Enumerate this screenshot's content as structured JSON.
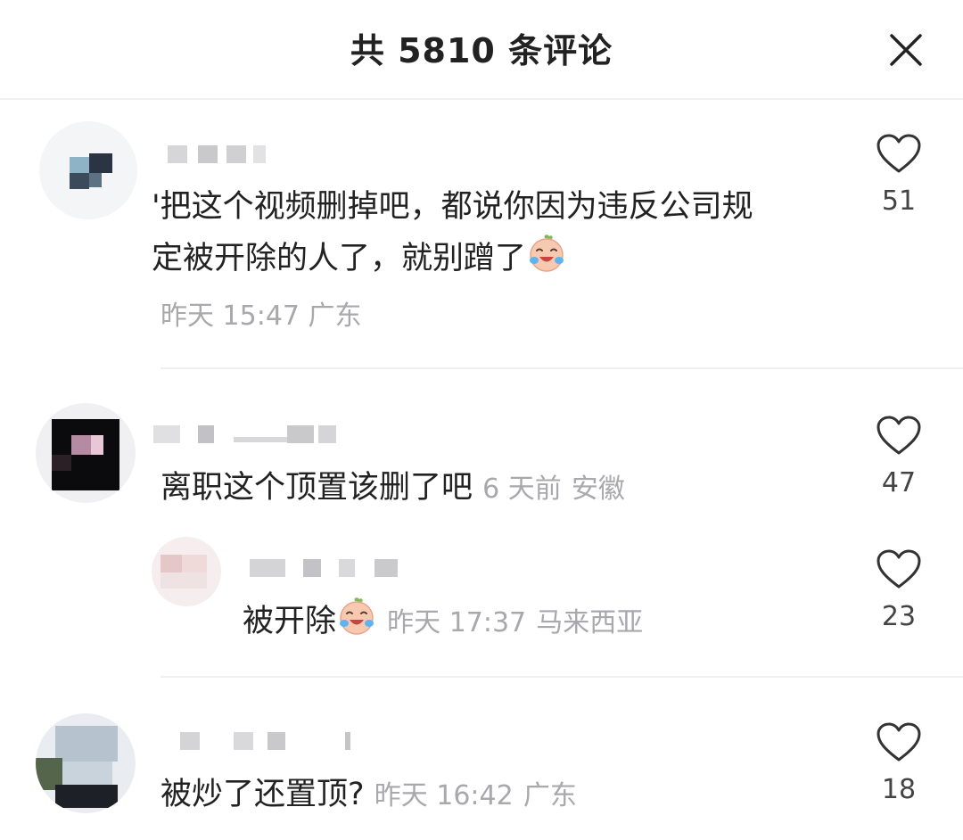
{
  "header": {
    "title": "共 5810 条评论"
  },
  "comments": [
    {
      "text": "'把这个视频删掉吧，都说你因为违反公司规定被开除的人了，就别蹭了",
      "line1": "'把这个视频删掉吧，都说你因为违反公司规",
      "line2": "定被开除的人了，就别蹭了",
      "time": "昨天 15:47",
      "location": "广东",
      "likes": "51",
      "emoji": "crying-laughing-face"
    },
    {
      "text": "离职这个顶置该删了吧",
      "time": "6 天前",
      "location": "安徽",
      "likes": "47"
    },
    {
      "text": "被开除",
      "time": "昨天 17:37",
      "location": "马来西亚",
      "likes": "23",
      "emoji": "crying-laughing-face",
      "is_reply": true
    },
    {
      "text": "被炒了还置顶?",
      "time": "昨天 16:42",
      "location": "广东",
      "likes": "18"
    }
  ],
  "icons": {
    "close": "close-icon",
    "like": "heart-outline-icon"
  },
  "colors": {
    "text": "#222222",
    "meta": "#a8a8ad",
    "divider": "#efefef",
    "background": "#ffffff"
  }
}
